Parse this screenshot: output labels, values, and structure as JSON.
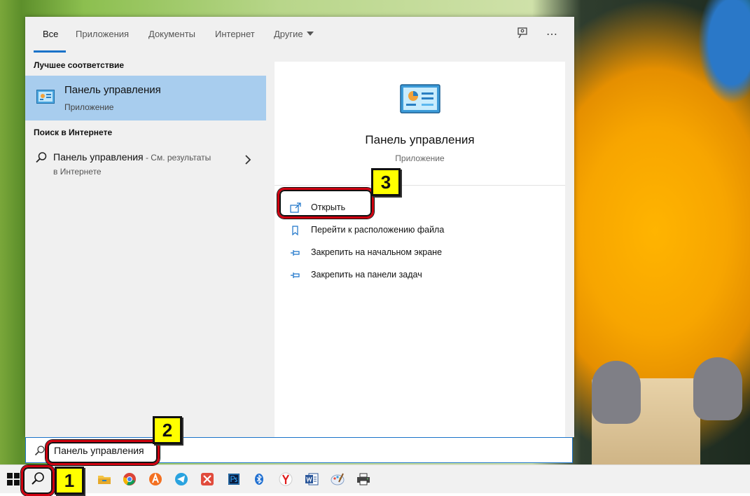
{
  "tabs": [
    {
      "label": "Все"
    },
    {
      "label": "Приложения"
    },
    {
      "label": "Документы"
    },
    {
      "label": "Интернет"
    },
    {
      "label": "Другие"
    }
  ],
  "left": {
    "best_match_title": "Лучшее соответствие",
    "best_match": {
      "name": "Панель управления",
      "type": "Приложение"
    },
    "web_title": "Поиск в Интернете",
    "web_item": {
      "query": "Панель управления",
      "suffix": " - См. результаты",
      "line2": "в Интернете"
    }
  },
  "preview": {
    "title": "Панель управления",
    "subtitle": "Приложение",
    "actions": [
      {
        "label": "Открыть"
      },
      {
        "label": "Перейти к расположению файла"
      },
      {
        "label": "Закрепить на начальном экране"
      },
      {
        "label": "Закрепить на панели задач"
      }
    ]
  },
  "search": {
    "value": "Панель управления"
  },
  "badges": {
    "b1": "1",
    "b2": "2",
    "b3": "3"
  },
  "colors": {
    "accent": "#1a73c9",
    "selection": "#a8cdee",
    "highlight": "#d00010",
    "badge": "#ffff00"
  },
  "taskbar_icons": [
    "windows-start-icon",
    "search-icon",
    "file-explorer-icon",
    "chrome-icon",
    "avast-icon",
    "telegram-icon",
    "close-app-icon",
    "photoshop-icon",
    "bluetooth-icon",
    "yandex-icon",
    "word-icon",
    "paint-icon",
    "printer-icon"
  ]
}
